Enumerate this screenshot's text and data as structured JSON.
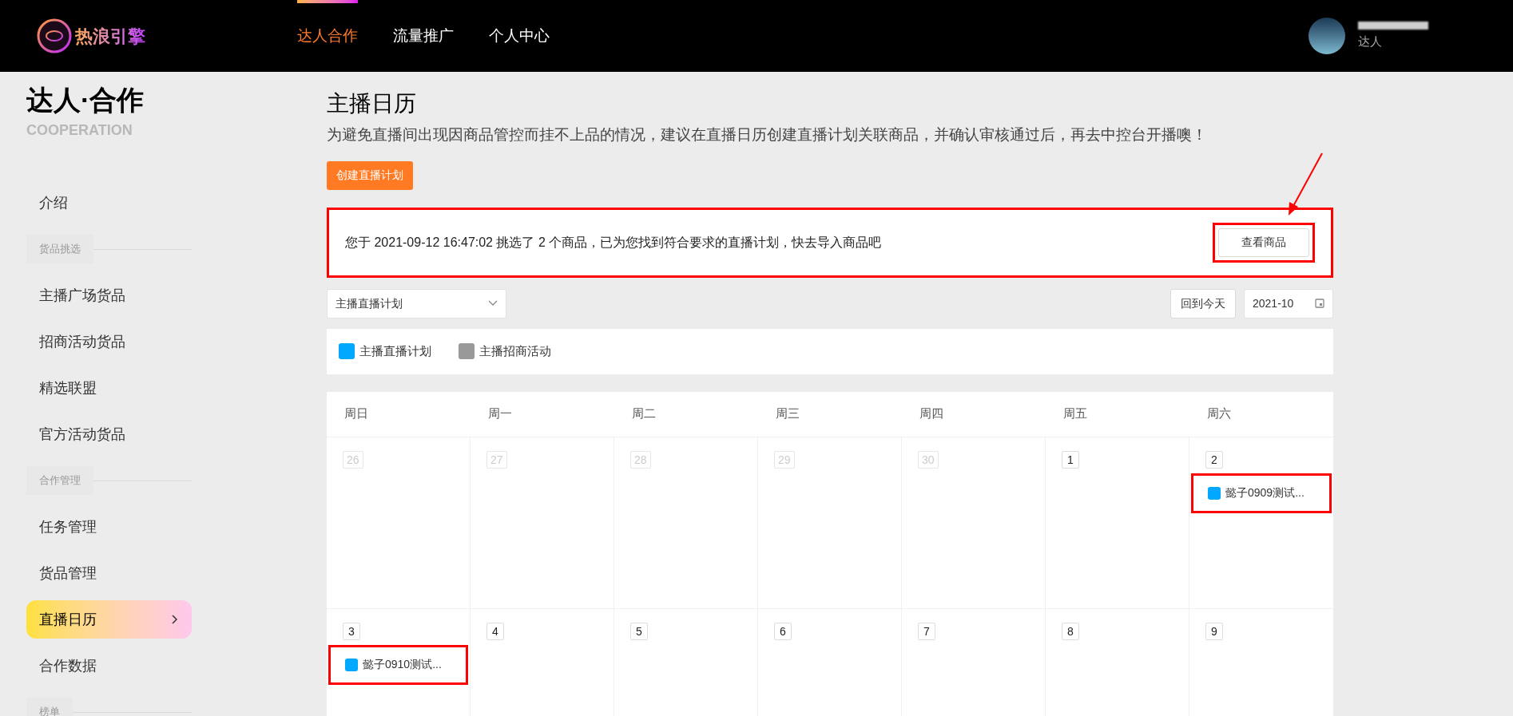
{
  "header": {
    "logo_text": "热浪引擎",
    "nav": [
      {
        "label": "达人合作",
        "selected": true
      },
      {
        "label": "流量推广",
        "selected": false
      },
      {
        "label": "个人中心",
        "selected": false
      }
    ],
    "user_role": "达人"
  },
  "sidebar": {
    "title": "达人·合作",
    "subtitle": "COOPERATION",
    "items": [
      {
        "kind": "item",
        "label": "介绍",
        "selected": false
      },
      {
        "kind": "section",
        "label": "货品挑选"
      },
      {
        "kind": "item",
        "label": "主播广场货品",
        "selected": false
      },
      {
        "kind": "item",
        "label": "招商活动货品",
        "selected": false
      },
      {
        "kind": "item",
        "label": "精选联盟",
        "selected": false
      },
      {
        "kind": "item",
        "label": "官方活动货品",
        "selected": false
      },
      {
        "kind": "section",
        "label": "合作管理"
      },
      {
        "kind": "item",
        "label": "任务管理",
        "selected": false
      },
      {
        "kind": "item",
        "label": "货品管理",
        "selected": false
      },
      {
        "kind": "item",
        "label": "直播日历",
        "selected": true
      },
      {
        "kind": "item",
        "label": "合作数据",
        "selected": false
      },
      {
        "kind": "section",
        "label": "榜单"
      }
    ]
  },
  "page": {
    "title": "主播日历",
    "description": "为避免直播间出现因商品管控而挂不上品的情况，建议在直播日历创建直播计划关联商品，并确认审核通过后，再去中控台开播噢！",
    "create_button": "创建直播计划"
  },
  "notice": {
    "text": "您于 2021-09-12 16:47:02 挑选了 2 个商品，已为您找到符合要求的直播计划，快去导入商品吧",
    "button": "查看商品"
  },
  "filter": {
    "select_value": "主播直播计划",
    "today_button": "回到今天",
    "month_value": "2021-10"
  },
  "legend": [
    {
      "label": "主播直播计划",
      "color": "#00a8ff"
    },
    {
      "label": "主播招商活动",
      "color": "#999999"
    }
  ],
  "calendar": {
    "weekdays": [
      "周日",
      "周一",
      "周二",
      "周三",
      "周四",
      "周五",
      "周六"
    ],
    "weeks": [
      [
        {
          "day": "26",
          "muted": true
        },
        {
          "day": "27",
          "muted": true
        },
        {
          "day": "28",
          "muted": true
        },
        {
          "day": "29",
          "muted": true
        },
        {
          "day": "30",
          "muted": true
        },
        {
          "day": "1",
          "muted": false
        },
        {
          "day": "2",
          "muted": false,
          "events": [
            {
              "title": "懿子0909测试...",
              "color": "#00a8ff"
            }
          ]
        }
      ],
      [
        {
          "day": "3",
          "muted": false,
          "events": [
            {
              "title": "懿子0910测试...",
              "color": "#00a8ff"
            }
          ]
        },
        {
          "day": "4",
          "muted": false
        },
        {
          "day": "5",
          "muted": false
        },
        {
          "day": "6",
          "muted": false
        },
        {
          "day": "7",
          "muted": false
        },
        {
          "day": "8",
          "muted": false
        },
        {
          "day": "9",
          "muted": false
        }
      ]
    ]
  }
}
